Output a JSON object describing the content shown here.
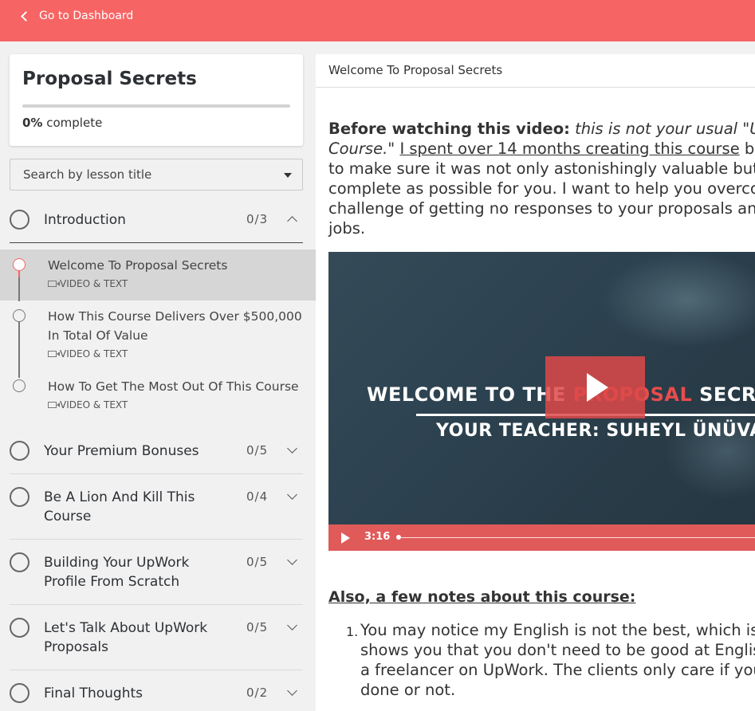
{
  "topbar": {
    "back_label": "Go to Dashboard"
  },
  "course": {
    "title": "Proposal Secrets",
    "progress_percent": "0%",
    "progress_suffix": "complete",
    "progress_value": 0
  },
  "search": {
    "placeholder": "Search by lesson title"
  },
  "sections": [
    {
      "title": "Introduction",
      "count": "0/3",
      "expanded": true
    },
    {
      "title": "Your Premium Bonuses",
      "count": "0/5"
    },
    {
      "title": "Be A Lion And Kill This Course",
      "count": "0/4"
    },
    {
      "title": "Building Your UpWork Profile From Scratch",
      "count": "0/5"
    },
    {
      "title": "Let's Talk About UpWork Proposals",
      "count": "0/5"
    },
    {
      "title": "Final Thoughts",
      "count": "0/2"
    }
  ],
  "lessons": [
    {
      "title": "Welcome To Proposal Secrets",
      "type": "VIDEO & TEXT",
      "active": true
    },
    {
      "title": "How This Course Delivers Over $500,000 In Total Of Value",
      "type": "VIDEO & TEXT"
    },
    {
      "title": "How To Get The Most Out Of This Course",
      "type": "VIDEO & TEXT"
    }
  ],
  "content": {
    "header": "Welcome To Proposal Secrets",
    "intro_bold": "Before watching this video:",
    "intro_italic_1": "this is not your usual \"Upwo",
    "intro_italic_2": "Course.\"",
    "intro_underline": "I spent over 14 months creating this course",
    "intro_rest_1": "beca",
    "intro_line3": "to make sure it was not only astonishingly valuable but als",
    "intro_line4": "complete as possible for you. I want to help you overcome",
    "intro_line5": "challenge of getting no responses to your proposals and f",
    "intro_line6": "jobs.",
    "video": {
      "line1_a": "WELCOME TO THE ",
      "line1_red": "PROPOSAL",
      "line1_b": " SECRETS C",
      "line2": "YOUR TEACHER: SUHEYL ÜNÜVAR",
      "time": "3:16"
    },
    "notes_title": "Also, a few notes about this course:",
    "note1_num": "1.",
    "note1_l1": "You may notice my English is not the best, which is tru",
    "note1_l2": "shows you that you don't need to be good at English t",
    "note1_l3": "a freelancer on UpWork. The clients only care if you ca",
    "note1_l4": "done or not."
  },
  "colors": {
    "accent": "#f76464",
    "video_bar": "#e05a5a"
  }
}
